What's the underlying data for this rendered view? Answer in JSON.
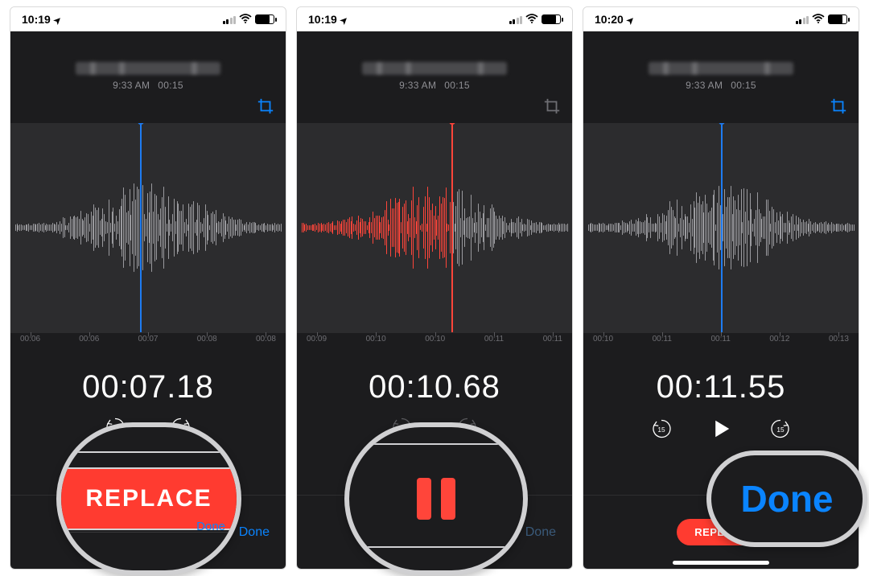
{
  "screens": [
    {
      "status": {
        "time": "10:19"
      },
      "header": {
        "sub_time": "9:33 AM",
        "duration": "00:15"
      },
      "ruler": [
        "00:06",
        "00:06",
        "00:07",
        "00:08",
        "00:08"
      ],
      "bigtime": "00:07.18",
      "action": {
        "replace_label": "REPLACE",
        "done_label": "Done"
      }
    },
    {
      "status": {
        "time": "10:19"
      },
      "header": {
        "sub_time": "9:33 AM",
        "duration": "00:15"
      },
      "ruler": [
        "00:09",
        "00:10",
        "00:10",
        "00:11",
        "00:11"
      ],
      "bigtime": "00:10.68",
      "action": {
        "done_label": "Done"
      }
    },
    {
      "status": {
        "time": "10:20"
      },
      "header": {
        "sub_time": "9:33 AM",
        "duration": "00:15"
      },
      "ruler": [
        "00:10",
        "00:11",
        "00:11",
        "00:12",
        "00:13"
      ],
      "bigtime": "00:11.55",
      "action": {
        "replace_label": "REPLACE",
        "done_label": "Done"
      }
    }
  ],
  "callouts": {
    "c1_label": "REPLACE",
    "c1_done": "Done",
    "c3_label": "Done"
  },
  "skip_back": "15",
  "skip_fwd": "15"
}
